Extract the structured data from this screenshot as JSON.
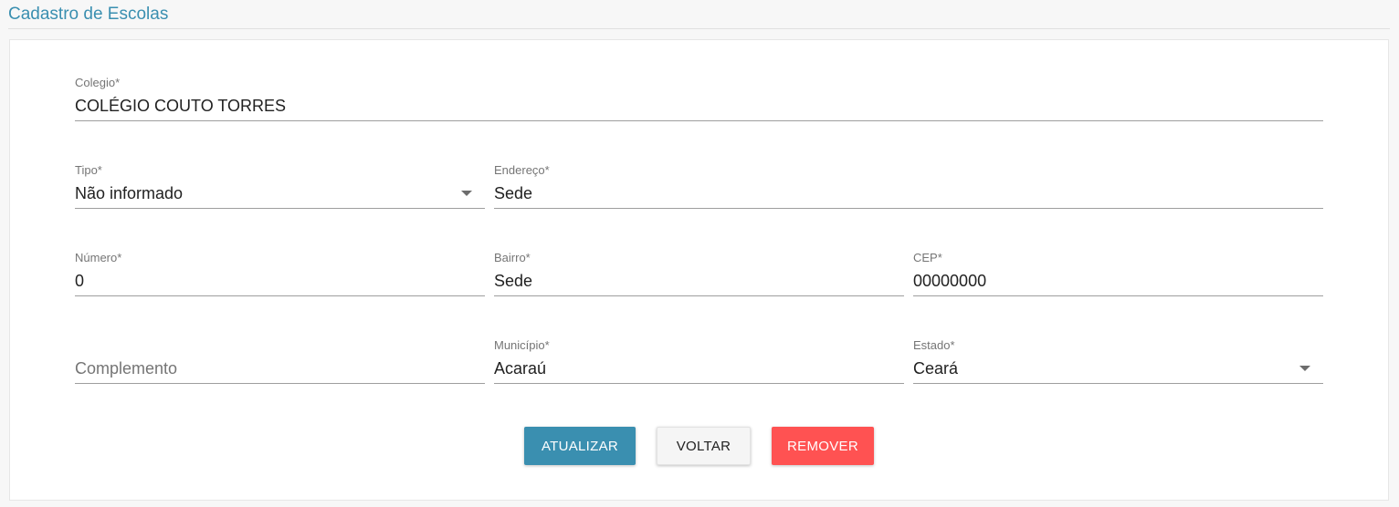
{
  "page": {
    "title": "Cadastro de Escolas"
  },
  "form": {
    "colegio": {
      "label": "Colegio*",
      "value": "COLÉGIO COUTO TORRES"
    },
    "tipo": {
      "label": "Tipo*",
      "value": "Não informado"
    },
    "endereco": {
      "label": "Endereço*",
      "value": "Sede"
    },
    "numero": {
      "label": "Número*",
      "value": "0"
    },
    "bairro": {
      "label": "Bairro*",
      "value": "Sede"
    },
    "cep": {
      "label": "CEP*",
      "value": "00000000"
    },
    "complemento": {
      "placeholder": "Complemento",
      "value": ""
    },
    "municipio": {
      "label": "Município*",
      "value": "Acaraú"
    },
    "estado": {
      "label": "Estado*",
      "value": "Ceará"
    }
  },
  "actions": {
    "update_label": "ATUALIZAR",
    "back_label": "VOLTAR",
    "remove_label": "REMOVER"
  },
  "colors": {
    "primary": "#3a8fb0",
    "danger": "#ff5252",
    "default_button": "#f5f5f5"
  }
}
